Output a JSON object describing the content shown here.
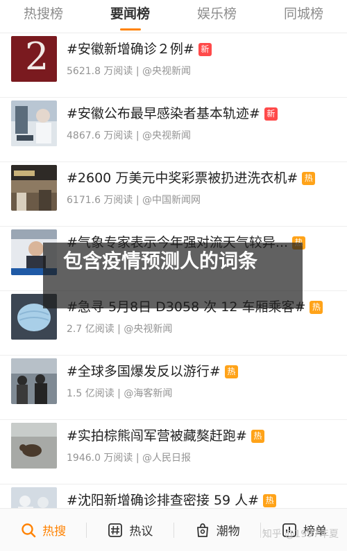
{
  "tabs": [
    {
      "label": "热搜榜",
      "active": false
    },
    {
      "label": "要闻榜",
      "active": true
    },
    {
      "label": "娱乐榜",
      "active": false
    },
    {
      "label": "同城榜",
      "active": false
    }
  ],
  "items": [
    {
      "title": "#安徽新增确诊２例#",
      "badge": "新",
      "badge_type": "new",
      "meta": "5621.8 万阅读 | @央视新闻",
      "thumb_text": "2"
    },
    {
      "title": "#安徽公布最早感染者基本轨迹#",
      "badge": "新",
      "badge_type": "new",
      "meta": "4867.6 万阅读 | @央视新闻"
    },
    {
      "title": "#2600 万美元中奖彩票被扔进洗衣机#",
      "badge": "热",
      "badge_type": "hot",
      "meta": "6171.6 万阅读 | @中国新闻网"
    },
    {
      "title": "#气象专家表示今年强对流天气较异...",
      "badge": "热",
      "badge_type": "hot",
      "meta": ""
    },
    {
      "title": "#急寻 5月8日 D3058 次 12 车厢乘客#",
      "badge": "热",
      "badge_type": "hot",
      "meta": "2.7 亿阅读 | @央视新闻"
    },
    {
      "title": "#全球多国爆发反以游行#",
      "badge": "热",
      "badge_type": "hot",
      "meta": "1.5 亿阅读 | @海客新闻"
    },
    {
      "title": "#实拍棕熊闯军营被藏獒赶跑#",
      "badge": "热",
      "badge_type": "hot",
      "meta": "1946.0 万阅读 | @人民日报"
    },
    {
      "title": "#沈阳新增确诊排查密接 59 人#",
      "badge": "热",
      "badge_type": "hot",
      "meta": ""
    }
  ],
  "overlay_text": "包含疫情预测人的词条",
  "bottom_nav": [
    {
      "label": "热搜",
      "icon": "search-icon",
      "active": true
    },
    {
      "label": "热议",
      "icon": "hashtag-icon",
      "active": false
    },
    {
      "label": "潮物",
      "icon": "bag-icon",
      "active": false
    },
    {
      "label": "榜单",
      "icon": "chart-icon",
      "active": false
    }
  ],
  "watermark": "知乎 @1997年夏",
  "colors": {
    "accent": "#ff8200",
    "badge_new": "#ff4a4a",
    "badge_hot": "#ffa319"
  }
}
